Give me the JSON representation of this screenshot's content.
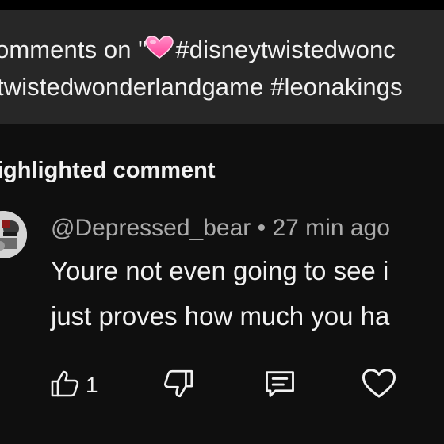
{
  "header": {
    "line1_prefix": "omments on \"",
    "line1_suffix": "#disneytwistedwonc",
    "line2": "twistedwonderlandgame #leonakings"
  },
  "section": {
    "title": "ighlighted comment"
  },
  "comment": {
    "author": "@Depressed_bear",
    "separator": " • ",
    "time": "27 min ago",
    "text_line1": "Youre not even going to see i",
    "text_line2": "just proves how much you ha"
  },
  "actions": {
    "like_count": "1"
  },
  "icons": {
    "heart_emoji": "pink-heart-icon",
    "like": "thumbs-up-icon",
    "dislike": "thumbs-down-icon",
    "reply": "comment-icon",
    "love": "heart-icon"
  },
  "colors": {
    "background": "#0f0f0f",
    "card": "#272727",
    "secondary_text": "#aaaaaa",
    "heart_pink": "#ff4fa3"
  }
}
